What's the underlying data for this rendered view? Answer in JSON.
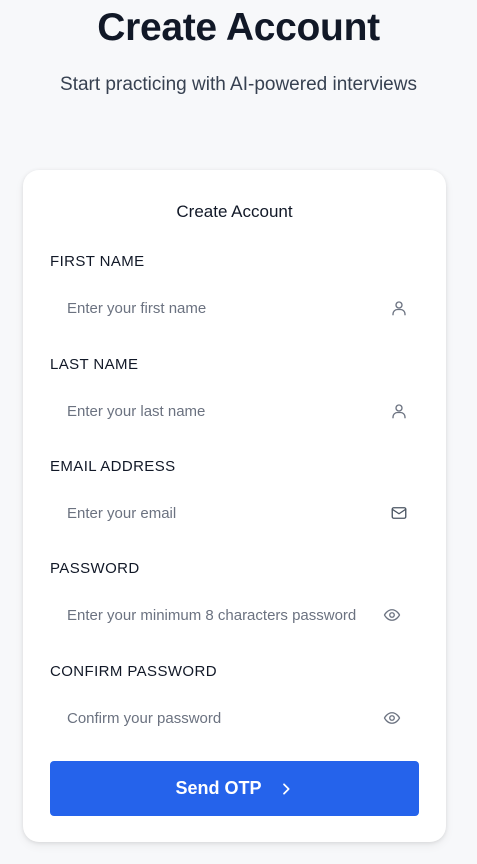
{
  "header": {
    "title": "Create Account",
    "subtitle": "Start practicing with AI-powered interviews"
  },
  "form": {
    "title": "Create Account",
    "fields": [
      {
        "label": "FIRST NAME",
        "placeholder": "Enter your first name",
        "icon": "user-icon"
      },
      {
        "label": "LAST NAME",
        "placeholder": "Enter your last name",
        "icon": "user-icon"
      },
      {
        "label": "EMAIL ADDRESS",
        "placeholder": "Enter your email",
        "icon": "mail-icon"
      },
      {
        "label": "PASSWORD",
        "placeholder": "Enter your minimum 8 characters password",
        "icon": "eye-icon"
      },
      {
        "label": "CONFIRM PASSWORD",
        "placeholder": "Confirm your password",
        "icon": "eye-icon"
      }
    ],
    "submit_label": "Send OTP",
    "submit_icon": "chevron-right-icon"
  },
  "colors": {
    "accent": "#2563eb",
    "background": "#f7f8fa",
    "card": "#ffffff",
    "text": "#111827",
    "placeholder": "#6b7280"
  }
}
